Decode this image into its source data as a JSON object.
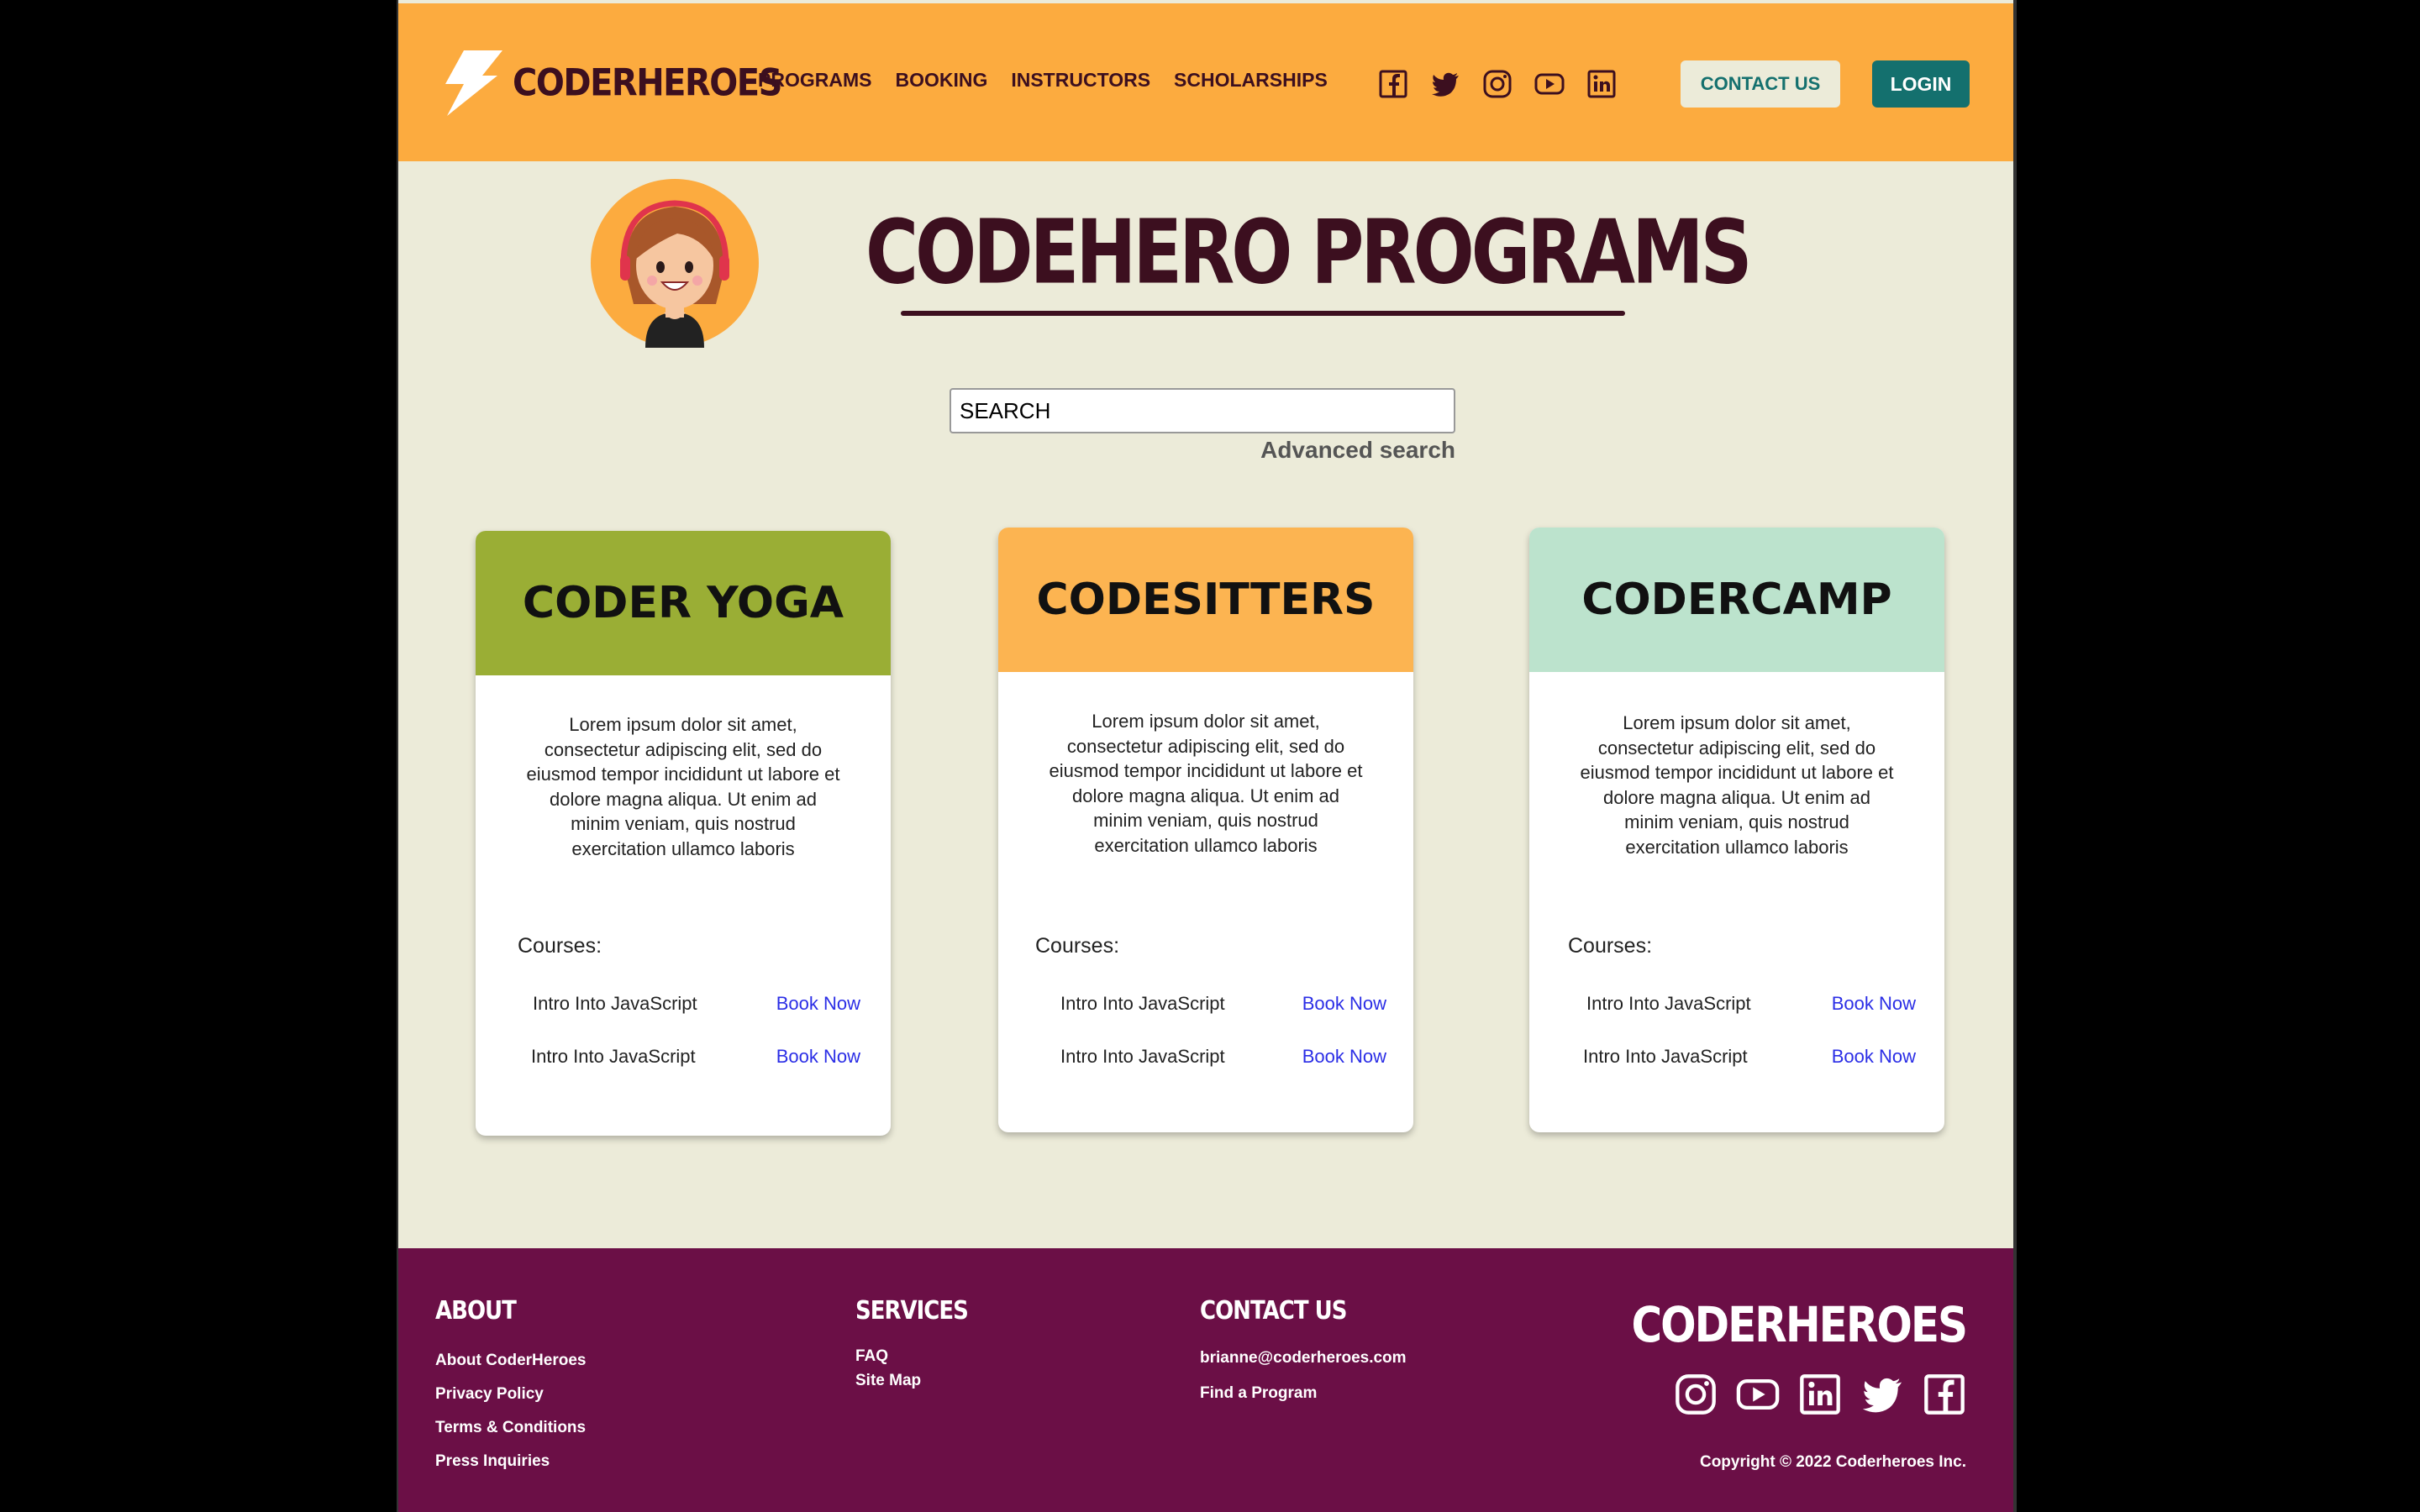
{
  "brand": {
    "name": "CODERHEROES",
    "colors": {
      "header_bg": "#fcab3f",
      "page_bg": "#ecebd9",
      "footer_bg": "#6b0f46",
      "dark_text": "#3c0f1f",
      "teal": "#14706e",
      "link_blue": "#2b2ee6"
    }
  },
  "nav": {
    "items": [
      "PROGRAMS",
      "BOOKING",
      "INSTRUCTORS",
      "SCHOLARSHIPS"
    ],
    "social_icons": [
      "facebook-icon",
      "twitter-icon",
      "instagram-icon",
      "youtube-icon",
      "linkedin-icon"
    ],
    "contact_label": "CONTACT US",
    "login_label": "LOGIN"
  },
  "hero": {
    "title": "CODEHERO PROGRAMS"
  },
  "search": {
    "placeholder": "SEARCH",
    "advanced_label": "Advanced search"
  },
  "programs": [
    {
      "title": "CODER YOGA",
      "color": "#9aae35",
      "description": "Lorem ipsum dolor sit amet, consectetur adipiscing elit, sed do eiusmod tempor incididunt ut labore et dolore magna aliqua. Ut enim ad minim veniam, quis nostrud exercitation ullamco laboris",
      "courses_label": "Courses:",
      "courses": [
        {
          "name": "Intro Into JavaScript",
          "action": "Book Now"
        },
        {
          "name": "Intro Into JavaScript",
          "action": "Book Now"
        }
      ]
    },
    {
      "title": "CODESITTERS",
      "color": "#fcb451",
      "description": "Lorem ipsum dolor sit amet, consectetur adipiscing elit, sed do eiusmod tempor incididunt ut labore et dolore magna aliqua. Ut enim ad minim veniam, quis nostrud exercitation ullamco laboris",
      "courses_label": "Courses:",
      "courses": [
        {
          "name": "Intro Into JavaScript",
          "action": "Book Now"
        },
        {
          "name": "Intro Into JavaScript",
          "action": "Book Now"
        }
      ]
    },
    {
      "title": "CODERCAMP",
      "color": "#bce3cd",
      "description": "Lorem ipsum dolor sit amet, consectetur adipiscing elit, sed do eiusmod tempor incididunt ut labore et dolore magna aliqua. Ut enim ad minim veniam, quis nostrud exercitation ullamco laboris",
      "courses_label": "Courses:",
      "courses": [
        {
          "name": "Intro Into JavaScript",
          "action": "Book Now"
        },
        {
          "name": "Intro Into JavaScript",
          "action": "Book Now"
        }
      ]
    }
  ],
  "footer": {
    "about": {
      "heading": "ABOUT",
      "links": [
        "About CoderHeroes",
        "Privacy Policy",
        "Terms & Conditions",
        "Press Inquiries"
      ]
    },
    "services": {
      "heading": "SERVICES",
      "links": [
        "FAQ",
        "Site Map"
      ]
    },
    "contact": {
      "heading": "CONTACT US",
      "links": [
        "brianne@coderheroes.com",
        "Find a Program"
      ]
    },
    "logo": "CODERHEROES",
    "social_icons": [
      "instagram-icon",
      "youtube-icon",
      "linkedin-icon",
      "twitter-icon",
      "facebook-icon"
    ],
    "copyright": "Copyright © 2022 Coderheroes Inc."
  }
}
